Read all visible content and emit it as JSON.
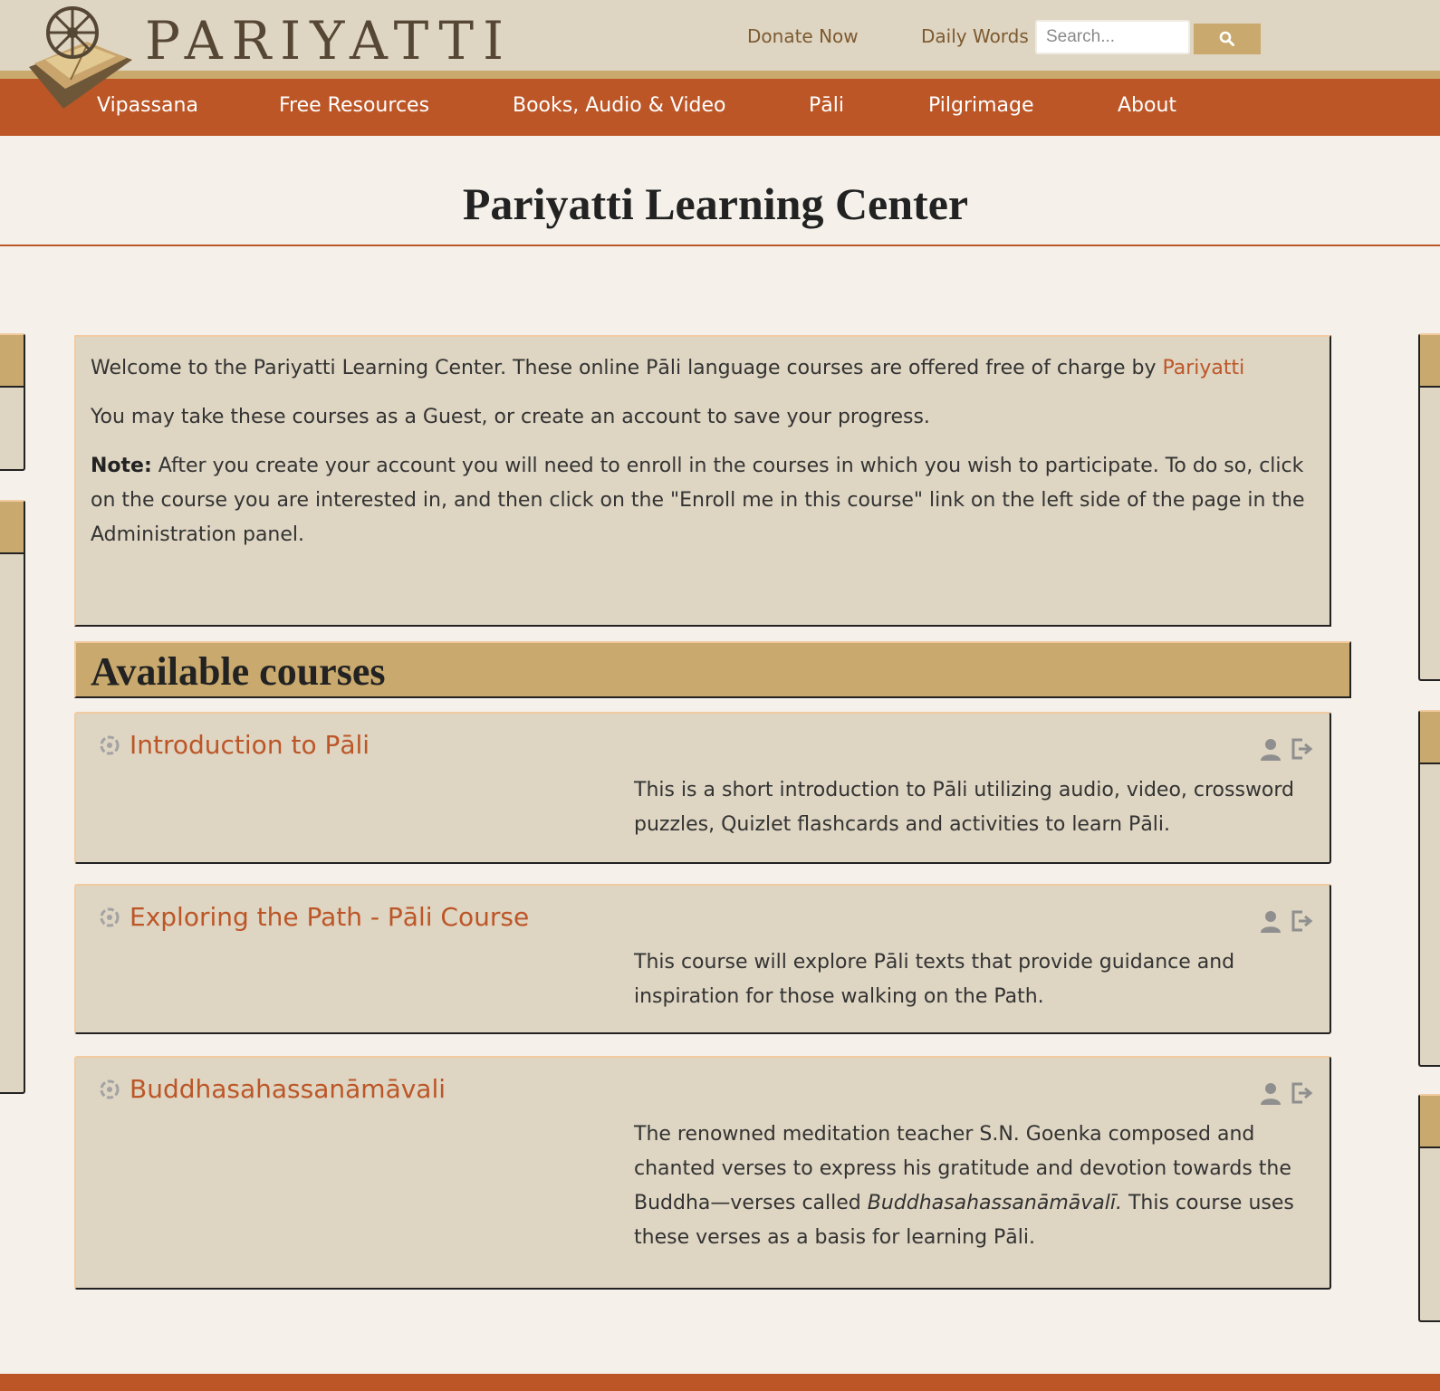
{
  "header": {
    "logo_text": "PARIYATTI",
    "links": {
      "donate": "Donate Now",
      "daily_words": "Daily Words"
    },
    "search": {
      "placeholder": "Search...",
      "value": ""
    }
  },
  "nav": {
    "items": [
      "Vipassana",
      "Free Resources",
      "Books, Audio & Video",
      "Pāli",
      "Pilgrimage",
      "About"
    ]
  },
  "page": {
    "title": "Pariyatti Learning Center"
  },
  "welcome": {
    "intro": "Welcome to the Pariyatti Learning Center. These online Pāli language courses are offered free of charge by ",
    "intro_link": "Pariyatti",
    "guest": "You may take these courses as a Guest, or create an account to save your progress.",
    "note_label": "Note:",
    "note": " After you create your account you will need to enroll in the courses in which you wish to participate. To do so, click on the course you are interested in, and then click on the \"Enroll me in this course\" link on the left side of the page in the Administration panel."
  },
  "available": {
    "heading": "Available courses"
  },
  "courses": [
    {
      "name": "Introduction to Pāli",
      "summary": "This is a short introduction to Pāli utilizing audio, video, crossword puzzles, Quizlet flashcards and activities to learn Pāli."
    },
    {
      "name": "Exploring the Path - Pāli Course",
      "summary": "This course will explore Pāli texts that provide guidance and inspiration for those walking on the Path."
    },
    {
      "name": "Buddhasahassanāmāvali",
      "summary_before": "The renowned meditation teacher S.N. Goenka composed and chanted verses to express his gratitude and devotion towards the Buddha—verses called ",
      "summary_italic": "Buddhasahassanāmāvalī.",
      "summary_after": " This course uses these verses as a basis for learning Pāli."
    }
  ],
  "colors": {
    "header_bg": "#ded5c2",
    "nav_bg": "#bc5627",
    "accent_gold": "#c9a96d",
    "link": "#bc5627",
    "page_bg": "#f5f1ea"
  },
  "icons": [
    "logo-dharma-wheel-book",
    "search-icon",
    "course-icon",
    "guest-access-icon",
    "self-enrol-icon"
  ]
}
